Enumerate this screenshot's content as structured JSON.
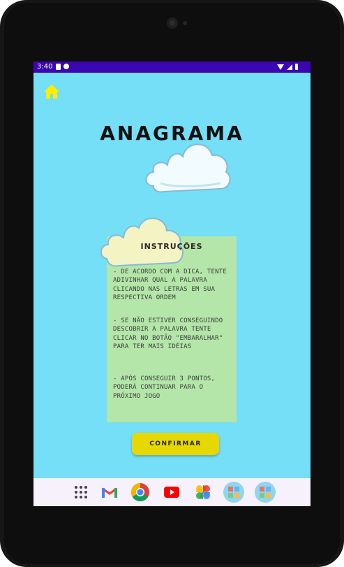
{
  "status_bar": {
    "time": "3:40"
  },
  "screen": {
    "title": "ANAGRAMA",
    "instructions": {
      "title": "INSTRUÇÕES",
      "items": [
        "- DE ACORDO COM A DICA, TENTE ADIVINHAR QUAL A PALAVRA CLICANDO NAS LETRAS EM SUA RESPECTIVA ORDEM",
        "- SE NÃO ESTIVER CONSEGUINDO DESCOBRIR A PALAVRA TENTE CLICAR NO BOTÃO \"EMBARALHAR\" PARA TER MAIS IDÉIAS",
        "- APÓS CONSEGUIR 3 PONTOS, PODERÁ CONTINUAR PARA O PRÓXIMO JOGO"
      ]
    },
    "confirm_label": "CONFIRMAR"
  },
  "dock_apps": [
    "app-grid-icon",
    "gmail-icon",
    "chrome-icon",
    "youtube-icon",
    "photos-icon",
    "game-app-icon",
    "game-app-icon"
  ],
  "colors": {
    "screen_bg": "#74dff6",
    "status_bar": "#3b07b3",
    "panel": "#b3e6a8",
    "button": "#e6d800",
    "home_icon": "#ffee00"
  }
}
